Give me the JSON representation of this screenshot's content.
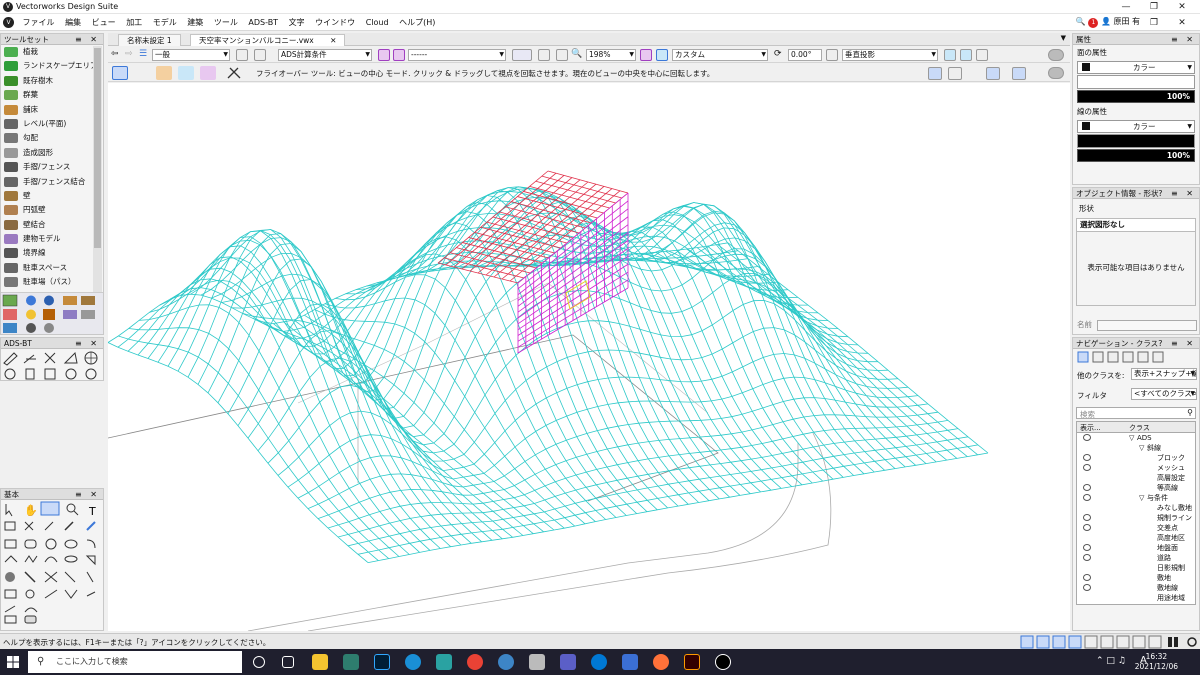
{
  "app": {
    "title": "Vectorworks Design Suite"
  },
  "menu": [
    "ファイル",
    "編集",
    "ビュー",
    "加工",
    "モデル",
    "建築",
    "ツール",
    "ADS-BT",
    "文字",
    "ウインドウ",
    "Cloud",
    "ヘルプ(H)"
  ],
  "user": {
    "name": "原田 有",
    "badge": "1"
  },
  "toolset": {
    "title": "ツールセット",
    "items": [
      "植栽",
      "ランドスケープエリア",
      "既存樹木",
      "群葉",
      "舗床",
      "レベル(平面)",
      "勾配",
      "造成図形",
      "手摺/フェンス",
      "手摺/フェンス結合",
      "壁",
      "円弧壁",
      "壁結合",
      "建物モデル",
      "境界線",
      "駐車スペース",
      "駐車場（パス）"
    ]
  },
  "ads_panel": {
    "title": "ADS-BT"
  },
  "basic_panel": {
    "title": "基本"
  },
  "tabs": [
    {
      "label": "名称未設定 1"
    },
    {
      "label": "天空率マンションバルコニー.vwx"
    }
  ],
  "viewbar": {
    "layer": "一般",
    "class": "ADS計算条件",
    "render": "------",
    "zoom": "198%",
    "view": "カスタム",
    "angle": "0.00°",
    "projection": "垂直投影"
  },
  "modebar": {
    "hint": "フライオーバー ツール: ビューの中心 モード. クリック & ドラッグして視点を回転させます。現在のビューの中央を中心に回転します。"
  },
  "attributes": {
    "title": "属性",
    "fill_label": "面の属性",
    "fill_type": "カラー",
    "fill_opacity": "100%",
    "line_label": "線の属性",
    "line_type": "カラー",
    "line_opacity": "100%"
  },
  "objinfo": {
    "title": "オブジェクト情報 - 形状",
    "tab": "形状",
    "selected": "選択図形なし",
    "empty": "表示可能な項目はありません",
    "name_label": "名前"
  },
  "navigation": {
    "title": "ナビゲーション - クラス",
    "other_classes_label": "他のクラスを:",
    "other_classes_value": "表示+スナップ+編集",
    "filter_label": "フィルタ",
    "filter_value": "<すべてのクラス>",
    "search_placeholder": "検索",
    "col_visibility": "表示...",
    "col_class": "クラス",
    "classes": [
      {
        "name": "ADS",
        "level": 0
      },
      {
        "name": "斜線",
        "level": 1
      },
      {
        "name": "ブロック",
        "level": 2
      },
      {
        "name": "メッシュ",
        "level": 2
      },
      {
        "name": "高層設定",
        "level": 2
      },
      {
        "name": "等高線",
        "level": 2
      },
      {
        "name": "与条件",
        "level": 1
      },
      {
        "name": "みなし敷地",
        "level": 2
      },
      {
        "name": "規制ライン",
        "level": 2
      },
      {
        "name": "交差点",
        "level": 2
      },
      {
        "name": "高度地区",
        "level": 2
      },
      {
        "name": "地盤面",
        "level": 2
      },
      {
        "name": "道路",
        "level": 2
      },
      {
        "name": "日影規制",
        "level": 2
      },
      {
        "name": "敷地",
        "level": 2
      },
      {
        "name": "敷地線",
        "level": 2
      },
      {
        "name": "用途地域",
        "level": 2
      }
    ]
  },
  "status": {
    "help": "ヘルプを表示するには、F1キーまたは「?」アイコンをクリックしてください。"
  },
  "taskbar": {
    "search_placeholder": "ここに入力して検索",
    "time": "16:32",
    "date": "2021/12/06",
    "ime": "A"
  },
  "colors": {
    "mesh": "#2ec9c9",
    "roof_red": "#e0304a",
    "roof_magenta": "#d020d0",
    "highlight": "#e8d020"
  }
}
